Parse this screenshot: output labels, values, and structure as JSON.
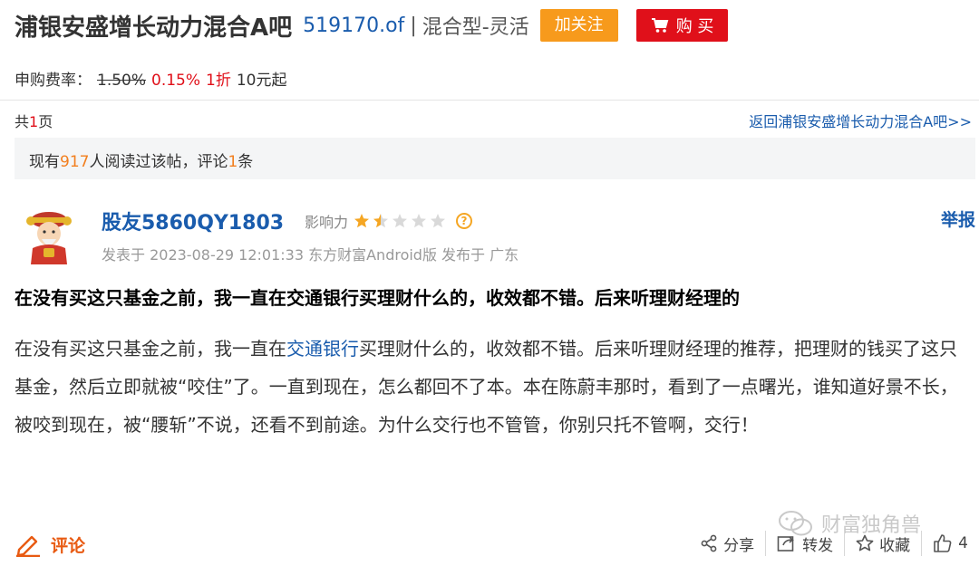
{
  "header": {
    "title": "浦银安盛增长动力混合A吧",
    "code": "519170.of",
    "separator": "|",
    "fund_type": "混合型-灵活",
    "follow_label": "加关注",
    "buy_label": "购 买"
  },
  "fee": {
    "label": "申购费率：",
    "original": "1.50%",
    "current": "0.15%",
    "discount": "1折",
    "minimum": "10元起"
  },
  "pagination": {
    "prefix": "共",
    "pages": "1",
    "suffix": "页",
    "back_link": "返回浦银安盛增长动力混合A吧>>"
  },
  "stats": {
    "prefix": "现有",
    "readers": "917",
    "middle": "人阅读过该帖，评论",
    "comments": "1",
    "suffix": "条"
  },
  "post": {
    "username": "股友5860QY1803",
    "influence_label": "影响力",
    "influence_stars": 1.5,
    "influence_max": 5,
    "help_symbol": "?",
    "report_label": "举报",
    "meta": "发表于 2023-08-29 12:01:33 东方财富Android版 发布于 广东",
    "title": "在没有买这只基金之前，我一直在交通银行买理财什么的，收效都不错。后来听理财经理的",
    "body_before": "在没有买这只基金之前，我一直在",
    "body_link": "交通银行",
    "body_after": "买理财什么的，收效都不错。后来听理财经理的推荐，把理财的钱买了这只基金，然后立即就被“咬住”了。一直到现在，怎么都回不了本。本在陈蔚丰那时，看到了一点曙光，谁知道好景不长，被咬到现在，被“腰斩”不说，还看不到前途。为什么交行也不管管，你别只托不管啊，交行！"
  },
  "footer": {
    "comment_label": "评论",
    "share_label": "分享",
    "forward_label": "转发",
    "favorite_label": "收藏",
    "like_count": "4"
  },
  "watermark": {
    "text": "财富独角兽"
  },
  "colors": {
    "link_blue": "#1a5cad",
    "follow_orange": "#f79a1c",
    "buy_red": "#e0101a",
    "comment_orange": "#e85a12",
    "star_gold": "#f5a623"
  }
}
